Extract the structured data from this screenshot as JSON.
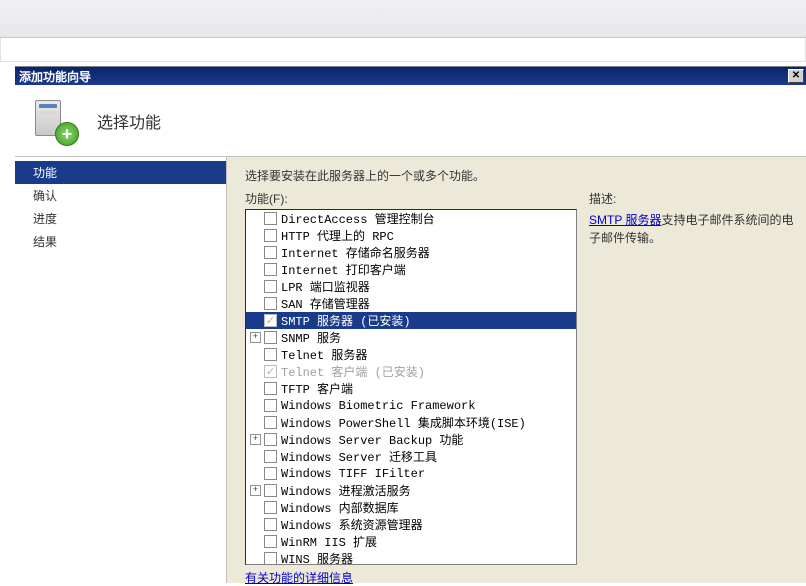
{
  "dialog": {
    "title": "添加功能向导",
    "header": "选择功能"
  },
  "nav": {
    "items": [
      {
        "label": "功能",
        "active": true
      },
      {
        "label": "确认"
      },
      {
        "label": "进度"
      },
      {
        "label": "结果"
      }
    ]
  },
  "content": {
    "instruction": "选择要安装在此服务器上的一个或多个功能。",
    "list_label": "功能(F):",
    "more_link": "有关功能的详细信息"
  },
  "features": [
    {
      "label": "DirectAccess 管理控制台",
      "exp": "",
      "checked": false
    },
    {
      "label": "HTTP 代理上的 RPC",
      "exp": "",
      "checked": false
    },
    {
      "label": "Internet 存储命名服务器",
      "exp": "",
      "checked": false
    },
    {
      "label": "Internet 打印客户端",
      "exp": "",
      "checked": false
    },
    {
      "label": "LPR 端口监视器",
      "exp": "",
      "checked": false
    },
    {
      "label": "SAN 存储管理器",
      "exp": "",
      "checked": false
    },
    {
      "label": "SMTP 服务器  (已安装)",
      "exp": "",
      "checked": true,
      "disabled": true,
      "selected": true
    },
    {
      "label": "SNMP 服务",
      "exp": "+",
      "checked": false
    },
    {
      "label": "Telnet 服务器",
      "exp": "",
      "checked": false
    },
    {
      "label": "Telnet 客户端 (已安装)",
      "exp": "",
      "checked": true,
      "disabled": true,
      "greyed": true
    },
    {
      "label": "TFTP 客户端",
      "exp": "",
      "checked": false
    },
    {
      "label": "Windows Biometric Framework",
      "exp": "",
      "checked": false
    },
    {
      "label": "Windows PowerShell 集成脚本环境(ISE)",
      "exp": "",
      "checked": false
    },
    {
      "label": "Windows Server Backup 功能",
      "exp": "+",
      "checked": false
    },
    {
      "label": "Windows Server 迁移工具",
      "exp": "",
      "checked": false
    },
    {
      "label": "Windows TIFF IFilter",
      "exp": "",
      "checked": false
    },
    {
      "label": "Windows 进程激活服务",
      "exp": "+",
      "checked": false
    },
    {
      "label": "Windows 内部数据库",
      "exp": "",
      "checked": false
    },
    {
      "label": "Windows 系统资源管理器",
      "exp": "",
      "checked": false
    },
    {
      "label": "WinRM IIS 扩展",
      "exp": "",
      "checked": false
    },
    {
      "label": "WINS 服务器",
      "exp": "",
      "checked": false
    }
  ],
  "description": {
    "header": "描述:",
    "link_text": "SMTP 服务器",
    "body_rest": "支持电子邮件系统间的电子邮件传输。"
  }
}
